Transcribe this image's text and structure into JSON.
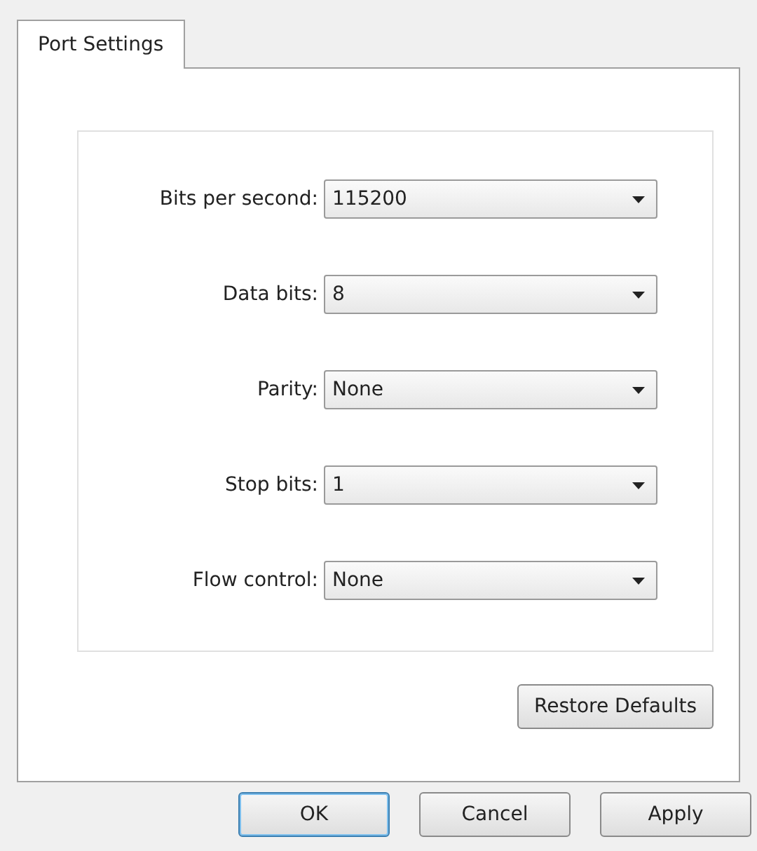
{
  "tabs": [
    {
      "label": "Port Settings",
      "selected": true
    }
  ],
  "fields": [
    {
      "label": "Bits per second:",
      "value": "115200"
    },
    {
      "label": "Data bits:",
      "value": "8"
    },
    {
      "label": "Parity:",
      "value": "None"
    },
    {
      "label": "Stop bits:",
      "value": "1"
    },
    {
      "label": "Flow control:",
      "value": "None"
    }
  ],
  "restore_button": "Restore Defaults",
  "buttons": [
    {
      "label": "OK",
      "default": true
    },
    {
      "label": "Cancel",
      "default": false
    },
    {
      "label": "Apply",
      "default": false
    }
  ]
}
